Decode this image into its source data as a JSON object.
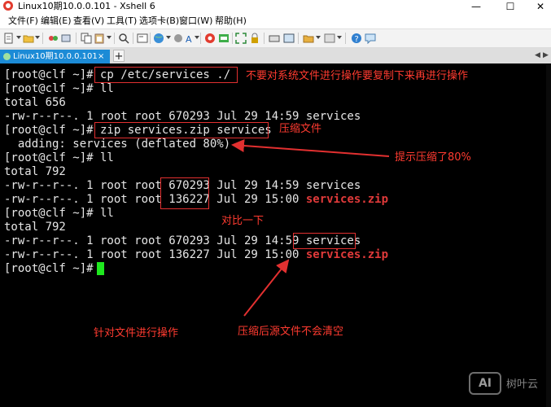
{
  "window": {
    "title": "Linux10期10.0.0.101 - Xshell 6",
    "minimize": "—",
    "maximize": "☐",
    "close": "✕"
  },
  "menu": [
    "文件(F)",
    "编辑(E)",
    "查看(V)",
    "工具(T)",
    "选项卡(B)",
    "窗口(W)",
    "帮助(H)"
  ],
  "tab": {
    "label": "Linux10期10.0.0.101",
    "close": "×",
    "add": "+"
  },
  "terminal": {
    "lines": [
      "[root@clf ~]# cp /etc/services ./",
      "[root@clf ~]# ll",
      "total 656",
      "-rw-r--r--. 1 root root 670293 Jul 29 14:59 services",
      "[root@clf ~]# zip services.zip services",
      "  adding: services (deflated 80%)",
      "[root@clf ~]# ll",
      "total 792",
      "-rw-r--r--. 1 root root 670293 Jul 29 14:59 services",
      "-rw-r--r--. 1 root root 136227 Jul 29 15:00 ",
      "[root@clf ~]# ll",
      "total 792",
      "-rw-r--r--. 1 root root 670293 Jul 29 14:59 services",
      "-rw-r--r--. 1 root root 136227 Jul 29 15:00 ",
      "[root@clf ~]# "
    ],
    "zip_name_1": "services.zip",
    "zip_name_2": "services.zip"
  },
  "annotations": {
    "note_cp": "不要对系统文件进行操作要复制下来再进行操作",
    "note_zip": "压缩文件",
    "note_ratio": "提示压缩了80%",
    "note_compare": "对比一下",
    "note_file_op": "针对文件进行操作",
    "note_source_kept": "压缩后源文件不会清空"
  },
  "watermark": {
    "logo": "AI",
    "text": "树叶云"
  },
  "colors": {
    "terminal_bg": "#000000",
    "terminal_fg": "#e6e6e6",
    "annotation_red": "#ff3b30",
    "cursor_green": "#1ee81e",
    "tab_active_blue": "#1c8bd6"
  }
}
